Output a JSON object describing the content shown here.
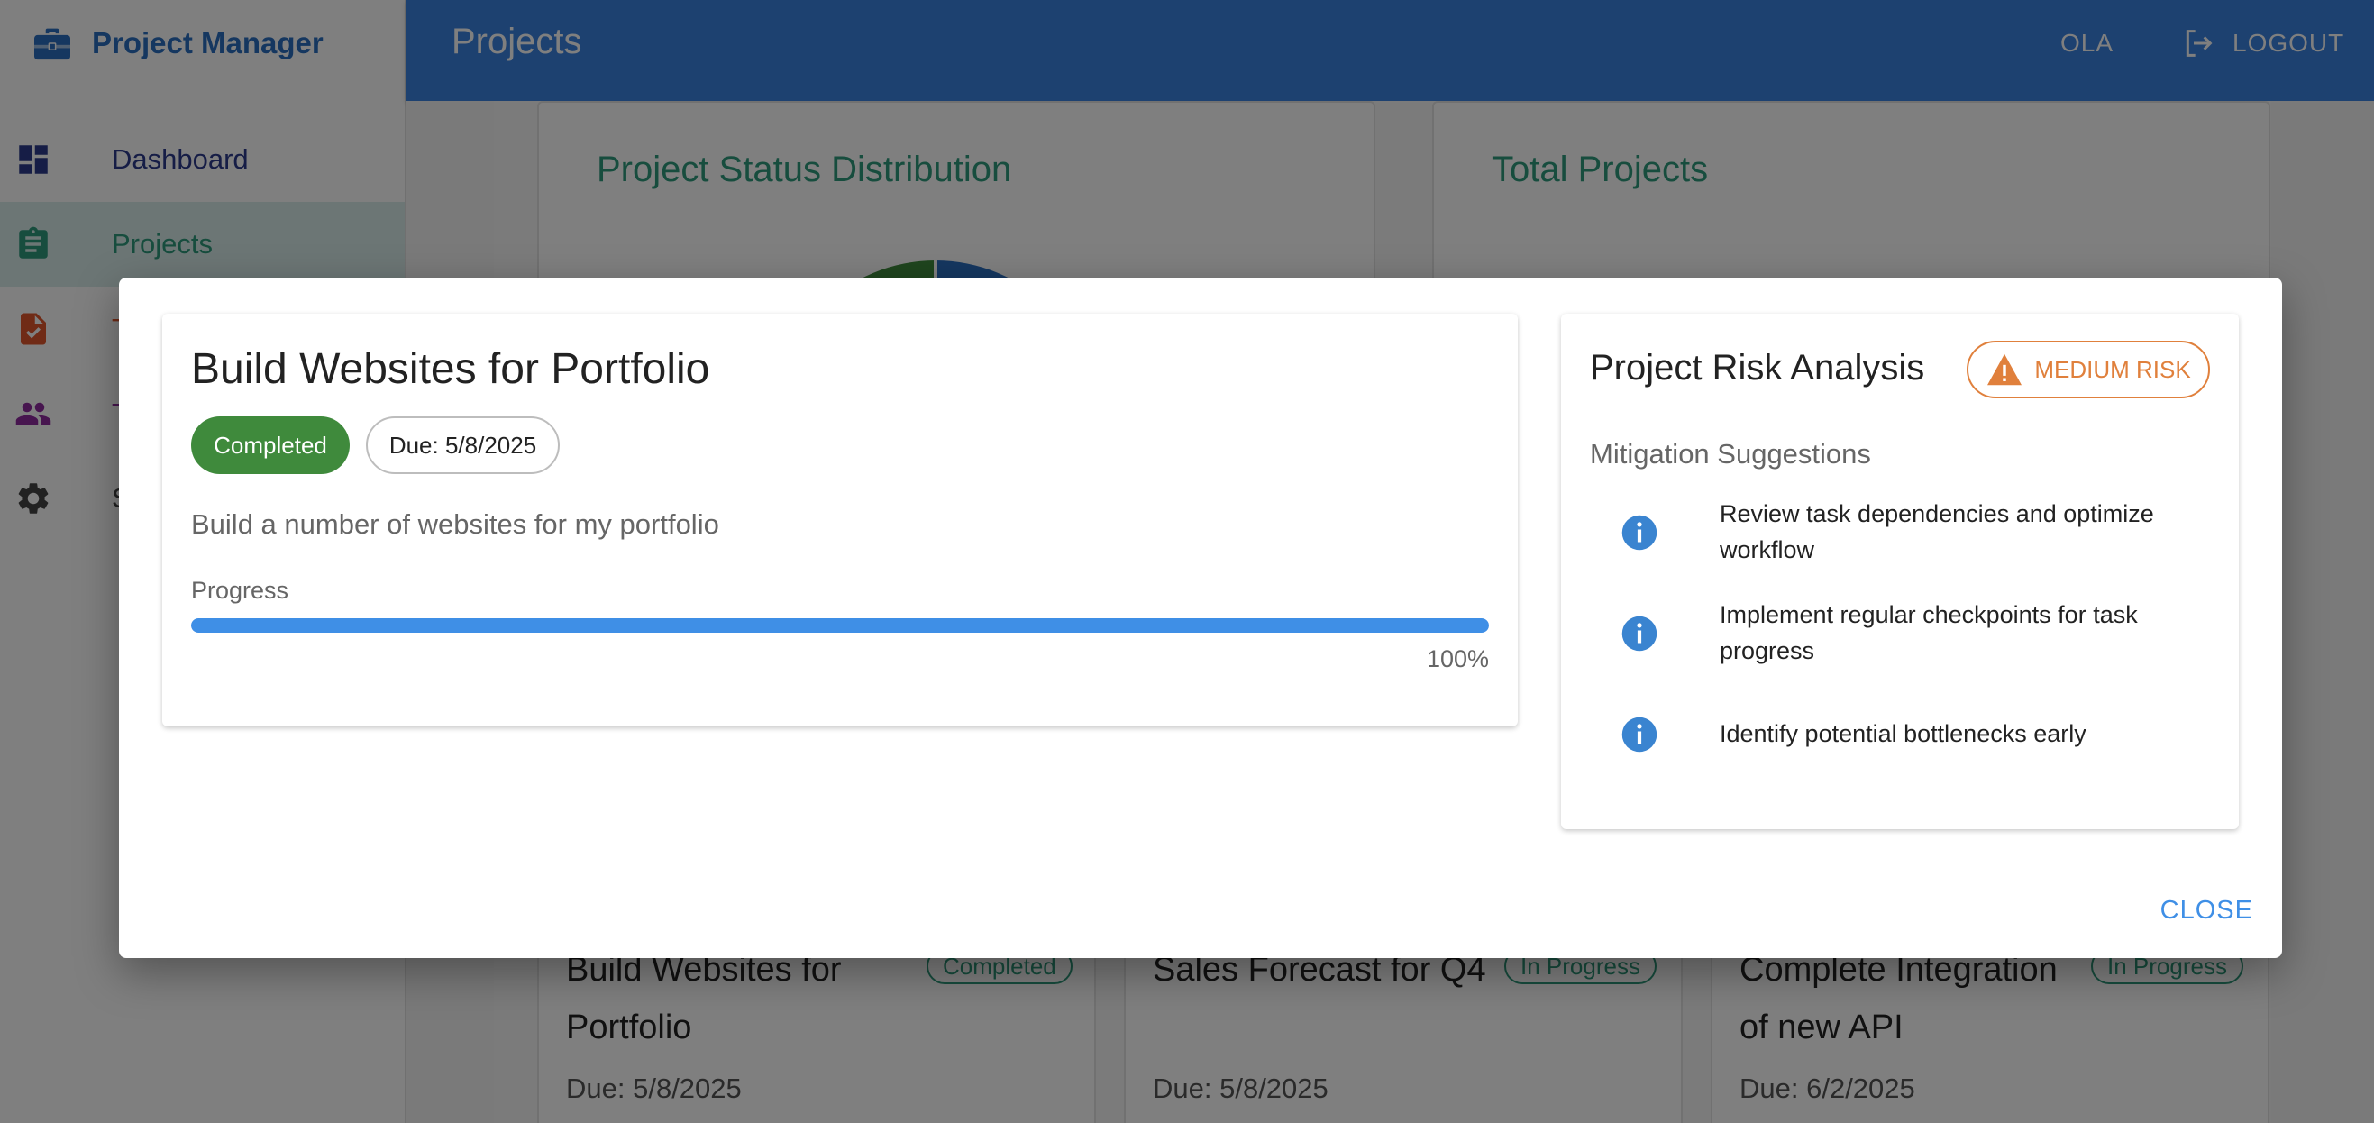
{
  "app": {
    "brand": "Project Manager",
    "page_title": "Projects",
    "user": "OLA",
    "logout_label": "LOGOUT"
  },
  "sidebar": {
    "items": [
      {
        "label": "Dashboard",
        "icon": "dashboard-icon",
        "color": "#2c3a8c"
      },
      {
        "label": "Projects",
        "icon": "clipboard-icon",
        "color": "#2e9a7c"
      },
      {
        "label": "T",
        "icon": "task-document-icon",
        "color": "#e0572c"
      },
      {
        "label": "T",
        "icon": "team-icon",
        "color": "#8e2a9e"
      },
      {
        "label": "S",
        "icon": "gear-icon",
        "color": "#444444"
      }
    ]
  },
  "background": {
    "chart_card_title": "Project Status Distribution",
    "total_card_title": "Total Projects",
    "projects": [
      {
        "title": "Build Websites for Portfolio",
        "status": "Completed",
        "due": "Due: 5/8/2025"
      },
      {
        "title": "Sales Forecast for Q4",
        "status": "In Progress",
        "due": "Due: 5/8/2025"
      },
      {
        "title": "Complete Integration of new API",
        "status": "In Progress",
        "due": "Due: 6/2/2025"
      }
    ]
  },
  "dialog": {
    "title": "Build Websites for Portfolio",
    "status": "Completed",
    "due": "Due: 5/8/2025",
    "description": "Build a number of websites for my portfolio",
    "progress_label": "Progress",
    "progress_value": 100,
    "progress_text": "100%",
    "risk": {
      "title": "Project Risk Analysis",
      "level": "MEDIUM RISK",
      "mitigation_title": "Mitigation Suggestions",
      "suggestions": [
        "Review task dependencies and optimize workflow",
        "Implement regular checkpoints for task progress",
        "Identify potential bottlenecks early"
      ]
    },
    "close_label": "CLOSE"
  },
  "colors": {
    "accent": "#3b82e0",
    "success": "#3f8a3c",
    "warning": "#e0803c",
    "teal": "#2e9a7c"
  }
}
